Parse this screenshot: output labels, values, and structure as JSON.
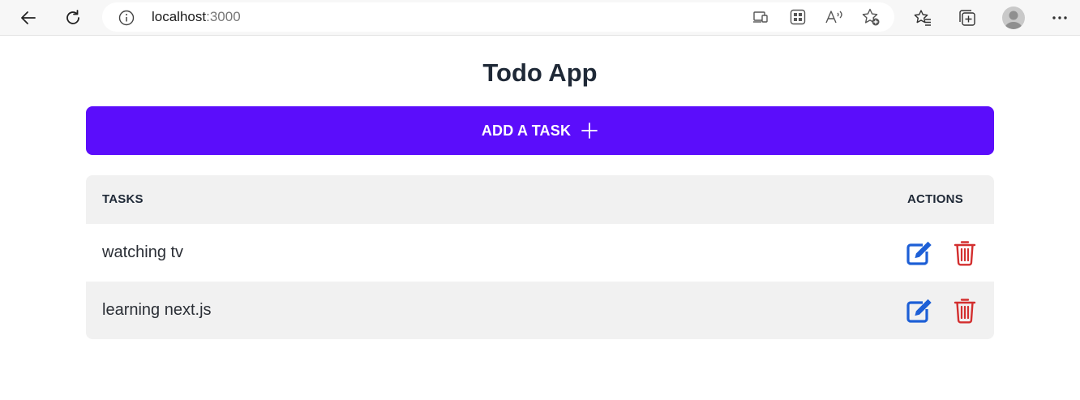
{
  "browser": {
    "url_host": "localhost",
    "url_port": ":3000"
  },
  "app": {
    "title": "Todo App",
    "add_task_label": "ADD A TASK",
    "table": {
      "header_tasks": "TASKS",
      "header_actions": "ACTIONS",
      "rows": [
        {
          "task": "watching tv"
        },
        {
          "task": "learning next.js"
        }
      ]
    }
  },
  "colors": {
    "accent": "#5b0dfb",
    "edit": "#1d5fd6",
    "delete": "#d32f2f",
    "table_header_bg": "#f1f1f1"
  },
  "icons": {
    "back": "back-arrow-icon",
    "refresh": "refresh-icon",
    "info": "info-icon",
    "cast": "cast-icon",
    "apps": "apps-icon",
    "read_aloud": "read-aloud-icon",
    "add_favorite": "add-favorite-icon",
    "favorites": "favorites-icon",
    "collections": "collections-icon",
    "profile": "avatar",
    "menu": "more-icon",
    "plus": "plus-icon",
    "edit": "edit-icon",
    "delete": "trash-icon"
  }
}
